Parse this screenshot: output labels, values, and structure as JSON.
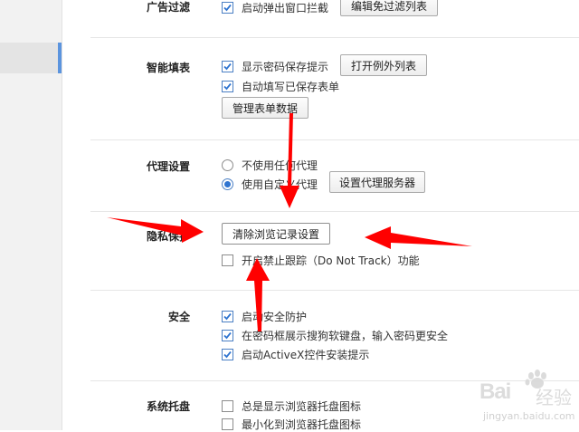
{
  "sections": {
    "ad_filter": {
      "label": "广告过滤",
      "popup_block": "启动弹出窗口拦截",
      "edit_button": "编辑免过滤列表"
    },
    "smart_fill": {
      "label": "智能填表",
      "show_password_prompt": "显示密码保存提示",
      "exceptions_button": "打开例外列表",
      "auto_fill": "自动填写已保存表单",
      "manage_button": "管理表单数据"
    },
    "proxy": {
      "label": "代理设置",
      "no_proxy": "不使用任何代理",
      "custom_proxy": "使用自定义代理",
      "proxy_button": "设置代理服务器"
    },
    "privacy": {
      "label": "隐私保护",
      "clear_button": "清除浏览记录设置",
      "dnt": "开启禁止跟踪（Do Not Track）功能"
    },
    "security": {
      "label": "安全",
      "safe_protect": "启动安全防护",
      "soft_keyboard": "在密码框展示搜狗软键盘，输入密码更安全",
      "activex_prompt": "启动ActiveX控件安装提示"
    },
    "tray": {
      "label": "系统托盘",
      "always_tray": "总是显示浏览器托盘图标",
      "minimize_tray": "最小化到浏览器托盘图标"
    }
  },
  "watermark": {
    "brand": "Bai",
    "brand2": "经验",
    "url": "jingyan.baidu.com"
  },
  "colors": {
    "annotation_arrow": "#ff0000",
    "accent": "#5b94de",
    "check": "#2f74d0"
  }
}
